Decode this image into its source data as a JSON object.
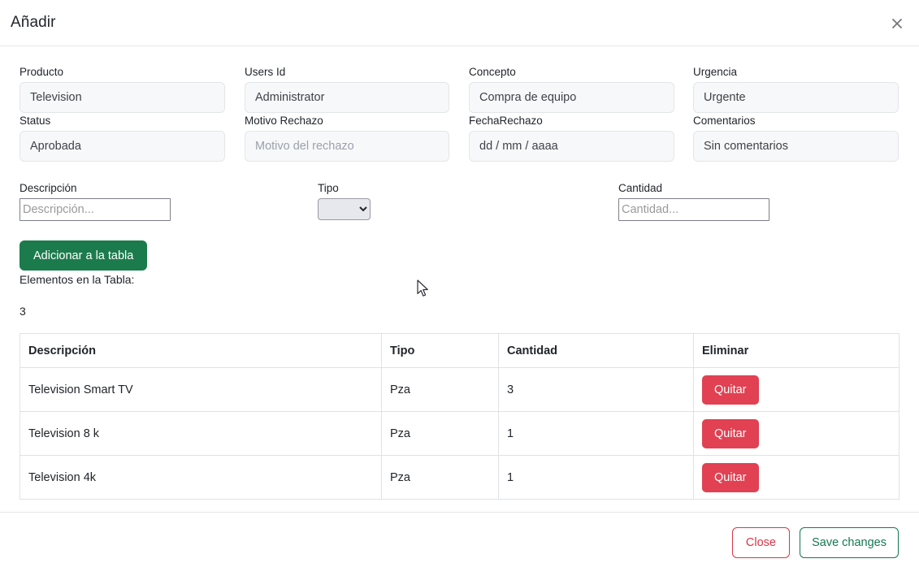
{
  "modal": {
    "title": "Añadir",
    "close_icon": "close-x-icon"
  },
  "form": {
    "fields": [
      {
        "label": "Producto",
        "value": "Television",
        "placeholder": ""
      },
      {
        "label": "Users Id",
        "value": "Administrator",
        "placeholder": ""
      },
      {
        "label": "Concepto",
        "value": "Compra de equipo",
        "placeholder": ""
      },
      {
        "label": "Urgencia",
        "value": "Urgente",
        "placeholder": ""
      },
      {
        "label": "Status",
        "value": "Aprobada",
        "placeholder": ""
      },
      {
        "label": "Motivo Rechazo",
        "value": "",
        "placeholder": "Motivo del rechazo"
      },
      {
        "label": "FechaRechazo",
        "value": "dd / mm / aaaa",
        "placeholder": "dd / mm / aaaa"
      },
      {
        "label": "Comentarios",
        "value": "Sin comentarios",
        "placeholder": ""
      }
    ],
    "descripcion": {
      "label": "Descripción",
      "value": "",
      "placeholder": "Descripción..."
    },
    "tipo": {
      "label": "Tipo",
      "selected": "",
      "options": [
        ""
      ]
    },
    "cantidad": {
      "label": "Cantidad",
      "value": "",
      "placeholder": "Cantidad..."
    },
    "add_button": "Adicionar a la tabla"
  },
  "table_section": {
    "count_label": "Elementos en la Tabla:",
    "count_value": "3",
    "columns": [
      "Descripción",
      "Tipo",
      "Cantidad",
      "Eliminar"
    ],
    "rows": [
      {
        "descripcion": "Television Smart TV",
        "tipo": "Pza",
        "cantidad": "3",
        "action": "Quitar"
      },
      {
        "descripcion": "Television 8 k",
        "tipo": "Pza",
        "cantidad": "1",
        "action": "Quitar"
      },
      {
        "descripcion": "Television 4k",
        "tipo": "Pza",
        "cantidad": "1",
        "action": "Quitar"
      }
    ]
  },
  "footer": {
    "close_label": "Close",
    "save_label": "Save changes"
  },
  "colors": {
    "success": "#1c7b4d",
    "danger": "#e14152",
    "close_outline": "#dc3545",
    "save_outline": "#14794f",
    "field_bg": "#f7f8f9",
    "border": "#dee2e6"
  }
}
